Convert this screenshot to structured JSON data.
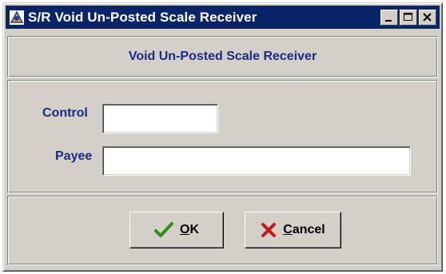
{
  "window": {
    "title": "S/R Void Un-Posted Scale Receiver",
    "minimize_icon": "minimize-icon",
    "maximize_icon": "maximize-icon",
    "close_icon": "close-icon"
  },
  "header": {
    "title": "Void Un-Posted Scale Receiver"
  },
  "form": {
    "control_label": "Control",
    "control_value": "",
    "payee_label": "Payee",
    "payee_value": ""
  },
  "buttons": {
    "ok_mnemonic": "O",
    "ok_rest": "K",
    "ok_icon": "checkmark-icon",
    "cancel_mnemonic": "C",
    "cancel_rest": "ancel",
    "cancel_icon": "x-icon"
  },
  "colors": {
    "titlebar": "#0a246a",
    "label": "#1a2a86",
    "face": "#d4d0c8",
    "ok_check": "#2e8b1e",
    "cancel_x": "#c81818"
  }
}
